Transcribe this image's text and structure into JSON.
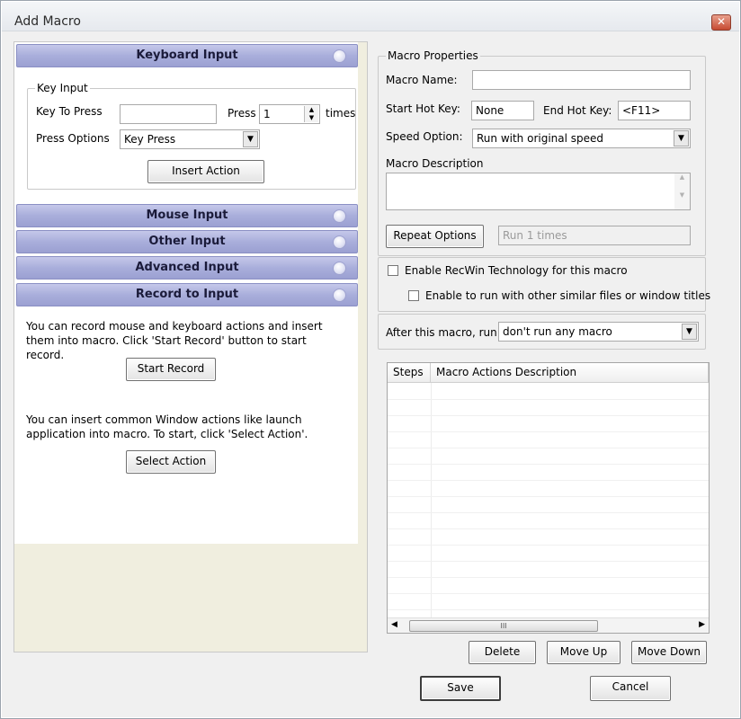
{
  "window": {
    "title": "Add Macro",
    "close_glyph": "✕"
  },
  "left": {
    "sections": {
      "keyboard": "Keyboard Input",
      "mouse": "Mouse Input",
      "other": "Other Input",
      "advanced": "Advanced Input",
      "record": "Record to Input"
    },
    "key_input": {
      "group_label": "Key Input",
      "key_to_press_label": "Key To Press",
      "key_to_press_value": "",
      "press_label": "Press",
      "press_value": "1",
      "times_label": "times",
      "press_options_label": "Press Options",
      "press_options_value": "Key Press",
      "insert_action": "Insert Action"
    },
    "record": {
      "desc1": "You can record mouse and keyboard actions and insert them into macro. Click 'Start Record' button to start record.",
      "start_record": "Start Record",
      "desc2": "You can insert common Window actions like launch application into macro. To start, click 'Select Action'.",
      "select_action": "Select Action"
    }
  },
  "props": {
    "group_label": "Macro Properties",
    "macro_name_label": "Macro Name:",
    "macro_name_value": "",
    "start_hotkey_label": "Start Hot Key:",
    "start_hotkey_value": "None",
    "end_hotkey_label": "End Hot Key:",
    "end_hotkey_value": "<F11>",
    "speed_label": "Speed Option:",
    "speed_value": "Run with original speed",
    "desc_label": "Macro Description",
    "desc_value": "",
    "repeat_button": "Repeat Options",
    "repeat_value": "Run 1 times",
    "recwin_label": "Enable RecWin Technology for this macro",
    "recwin_checked": false,
    "similar_label": "Enable to run with other similar files or window titles",
    "similar_checked": false,
    "after_label": "After this macro, run",
    "after_value": "don't run any macro"
  },
  "steps": {
    "col_steps": "Steps",
    "col_desc": "Macro Actions Description",
    "rows": [],
    "scroll_grip": "III"
  },
  "buttons": {
    "delete": "Delete",
    "move_up": "Move Up",
    "move_down": "Move Down",
    "save": "Save",
    "cancel": "Cancel"
  }
}
